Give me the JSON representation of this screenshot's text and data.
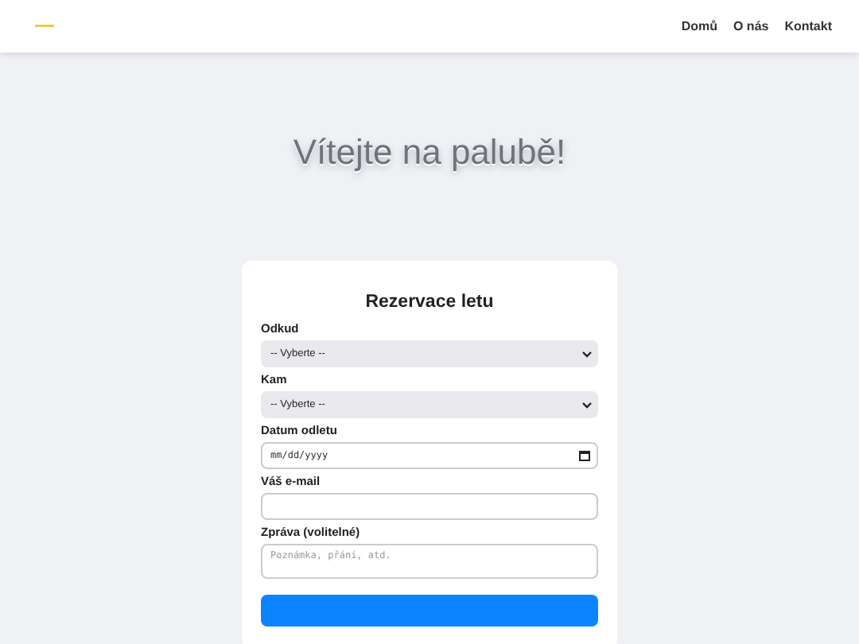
{
  "nav": {
    "links": [
      "Domů",
      "O nás",
      "Kontakt"
    ]
  },
  "hero": {
    "title": "Vítejte na palubě!"
  },
  "form": {
    "title": "Rezervace letu",
    "fields": [
      {
        "kind": "select",
        "label": "Odkud",
        "value": "-- Vyberte --"
      },
      {
        "kind": "select",
        "label": "Kam",
        "value": "-- Vyberte --"
      },
      {
        "kind": "date",
        "label": "Datum odletu",
        "value": "mm/dd/yyyy"
      },
      {
        "kind": "text",
        "label": "Váš e-mail"
      },
      {
        "kind": "textarea",
        "label": "Zpráva (volitelné)",
        "placeholder": "Poznámka, přání, atd."
      }
    ]
  }
}
